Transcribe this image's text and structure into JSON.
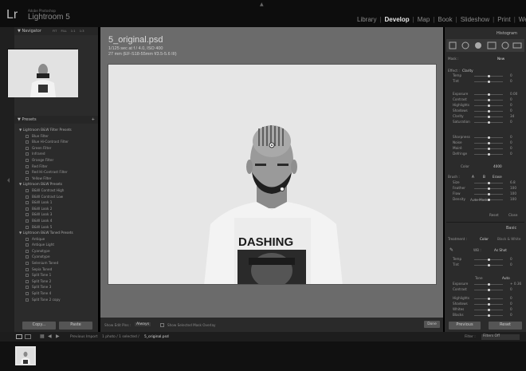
{
  "app": {
    "logo": "Lr",
    "subtitle_small": "Adobe Photoshop",
    "subtitle": "Lightroom 5"
  },
  "modules": [
    "Library",
    "Develop",
    "Map",
    "Book",
    "Slideshow",
    "Print",
    "We"
  ],
  "active_module": "Develop",
  "navigator": {
    "title": "Navigator",
    "zoom_options": [
      "FIT",
      "FILL",
      "1:1",
      "1:3"
    ]
  },
  "presets": {
    "title": "Presets",
    "groups": [
      {
        "name": "Lightroom B&W Filter Presets",
        "items": [
          "Blue Filter",
          "Blue Hi-Contrast Filter",
          "Green Filter",
          "Infrared",
          "Orange Filter",
          "Red Filter",
          "Red Hi-Contrast Filter",
          "Yellow Filter"
        ]
      },
      {
        "name": "Lightroom B&W Presets",
        "items": [
          "B&W Contrast High",
          "B&W Contrast Low",
          "B&W Look 1",
          "B&W Look 2",
          "B&W Look 3",
          "B&W Look 4",
          "B&W Look 5"
        ]
      },
      {
        "name": "Lightroom B&W Toned Presets",
        "items": [
          "Antique",
          "Antique Light",
          "Cyanotype",
          "Cyanotype",
          "Selenium Toned",
          "Sepia Toned",
          "Split Tone 1",
          "Split Tone 2",
          "Split Tone 3",
          "Split Tone 4",
          "Split Tone 2 copy"
        ]
      }
    ]
  },
  "left_buttons": {
    "copy": "Copy...",
    "paste": "Paste"
  },
  "photo": {
    "filename": "5_original.psd",
    "exposure": "1/125 sec at f / 4.0, ISO 400",
    "lens": "27 mm (EF-S18-55mm f/3.5-5.6 III)",
    "shirt_text": "DASHING"
  },
  "toolbar": {
    "show_edit_pins_label": "Show Edit Pins :",
    "show_edit_pins_value": "Always",
    "show_mask_label": "Show Selected Mask Overlay",
    "done": "Done"
  },
  "right_panel": {
    "histogram_title": "Histogram",
    "mask_label": "Mask :",
    "new_label": "New",
    "effect_label": "Effect :",
    "effect_value": "Clarity",
    "sliders_top": [
      {
        "name": "Temp",
        "value": "0"
      },
      {
        "name": "Tint",
        "value": "0"
      }
    ],
    "sliders_mid": [
      {
        "name": "Exposure",
        "value": "0.00"
      },
      {
        "name": "Contrast",
        "value": "0"
      },
      {
        "name": "Highlights",
        "value": "0"
      },
      {
        "name": "Shadows",
        "value": "0"
      },
      {
        "name": "Clarity",
        "value": "34"
      },
      {
        "name": "Saturation",
        "value": "0"
      }
    ],
    "sliders_detail": [
      {
        "name": "Sharpness",
        "value": "0"
      },
      {
        "name": "Noise",
        "value": "0"
      },
      {
        "name": "Moiré",
        "value": "0"
      },
      {
        "name": "Defringe",
        "value": "0"
      }
    ],
    "color_label": "Color",
    "color_value": "4000",
    "brush": {
      "label": "Brush :",
      "a": "A",
      "b": "B",
      "erase": "Erase"
    },
    "brush_sliders": [
      {
        "name": "Size",
        "value": "6.8"
      },
      {
        "name": "Feather",
        "value": "100"
      },
      {
        "name": "Flow",
        "value": "100"
      },
      {
        "name": "Density",
        "value": "100"
      }
    ],
    "auto_mask": "Auto Mask",
    "reset": "Reset",
    "close": "Close",
    "basic_title": "Basic",
    "treatment_label": "Treatment :",
    "treatment_color": "Color",
    "treatment_bw": "Black & White",
    "wb_label": "WB :",
    "wb_value": "As Shot",
    "basic_top": [
      {
        "name": "Temp",
        "value": "0"
      },
      {
        "name": "Tint",
        "value": "0"
      }
    ],
    "tone_label": "Tone",
    "auto_label": "Auto",
    "basic_tone": [
      {
        "name": "Exposure",
        "value": "+ 0.36"
      },
      {
        "name": "Contrast",
        "value": "0"
      }
    ],
    "basic_bottom": [
      {
        "name": "Highlights",
        "value": "0"
      },
      {
        "name": "Shadows",
        "value": "0"
      },
      {
        "name": "Whites",
        "value": "0"
      },
      {
        "name": "Blacks",
        "value": "0"
      }
    ],
    "previous": "Previous",
    "reset_button": "Reset"
  },
  "filmstrip": {
    "source": "Previous Import",
    "count": "1 photo / 1 selected /",
    "filename": "5_original.psd",
    "filter_label": "Filter :",
    "filter_value": "Filters Off"
  }
}
